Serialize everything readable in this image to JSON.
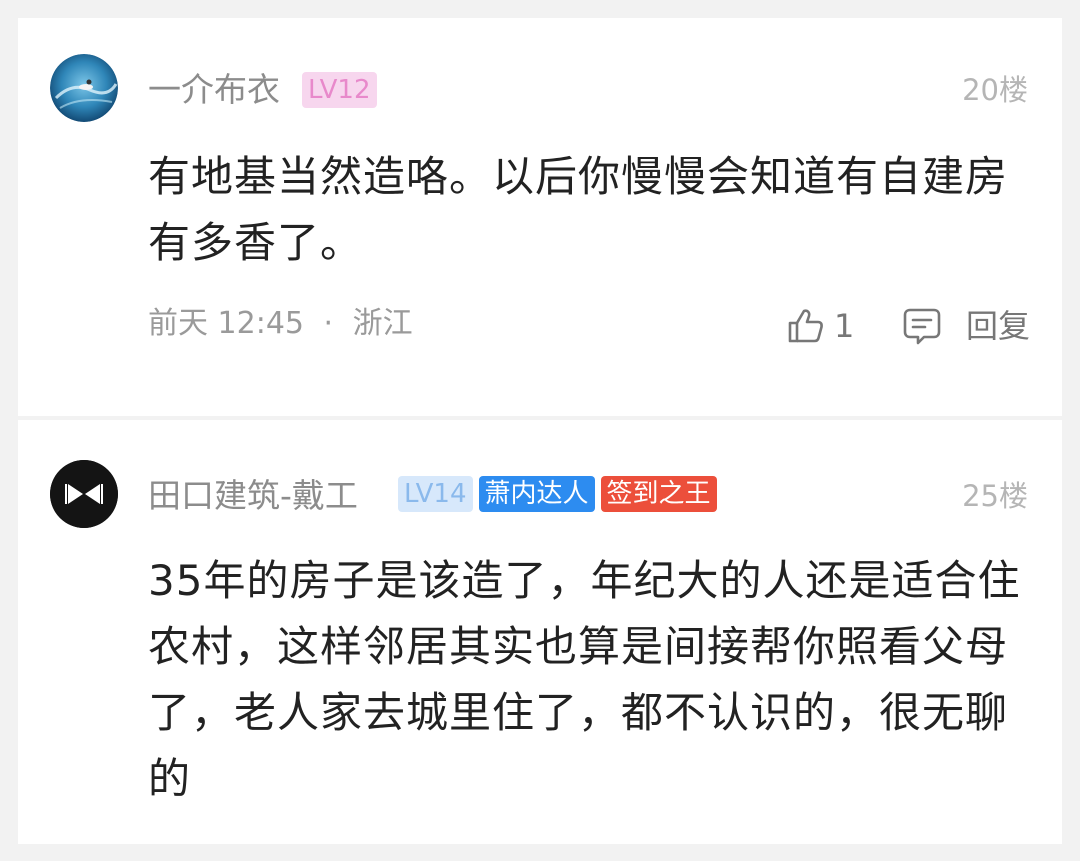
{
  "comments": [
    {
      "username": "一介布衣",
      "badges": [
        {
          "text": "LV12",
          "bg": "#f7d6ee",
          "fg": "#e889cb"
        }
      ],
      "floor": "20楼",
      "content": "有地基当然造咯。以后你慢慢会知道有自建房有多香了。",
      "time": "前天 12:45",
      "separator": "·",
      "location": "浙江",
      "like_count": "1",
      "reply_label": "回复",
      "icons": {
        "like": "thumbs-up-icon",
        "reply": "comment-icon"
      }
    },
    {
      "username": "田口建筑-戴工",
      "badges": [
        {
          "text": "LV14",
          "bg": "#d7e8fb",
          "fg": "#8ab9ec"
        },
        {
          "text": "萧内达人",
          "bg": "#2d8cf0",
          "fg": "#ffffff"
        },
        {
          "text": "签到之王",
          "bg": "#ec4f3b",
          "fg": "#ffffff"
        }
      ],
      "floor": "25楼",
      "content": "35年的房子是该造了，年纪大的人还是适合住农村，这样邻居其实也算是间接帮你照看父母了，老人家去城里住了，都不认识的，很无聊的"
    }
  ],
  "colors": {
    "background": "#f2f2f2",
    "card": "#ffffff",
    "text": "#222222"
  }
}
